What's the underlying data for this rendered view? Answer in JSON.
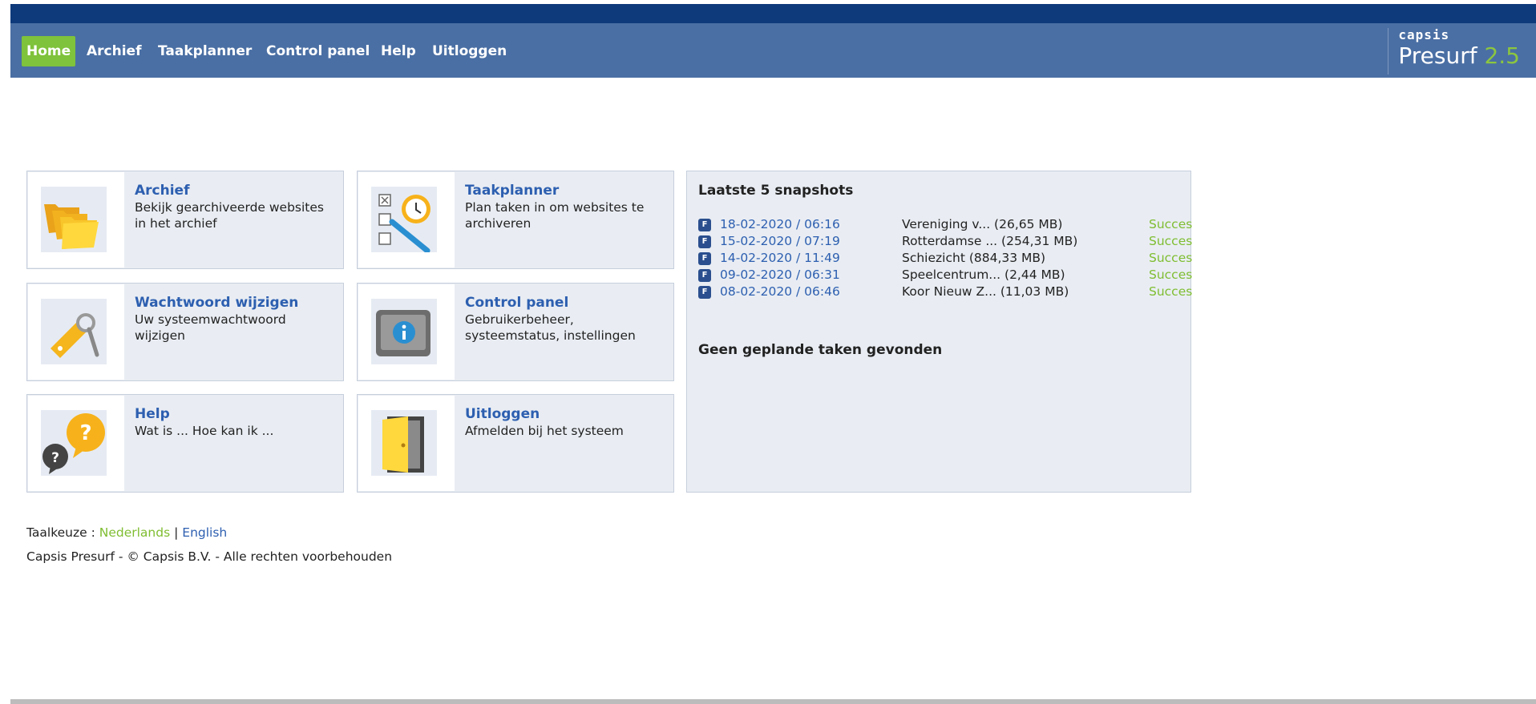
{
  "nav": {
    "items": [
      {
        "label": "Home",
        "active": true
      },
      {
        "label": "Archief"
      },
      {
        "label": "Taakplanner"
      },
      {
        "label": "Control panel"
      },
      {
        "label": "Help"
      },
      {
        "label": "Uitloggen"
      }
    ]
  },
  "logo": {
    "small": "capsis",
    "product": "Presurf",
    "version": "2.5"
  },
  "tiles": [
    {
      "title": "Archief",
      "desc": "Bekijk gearchiveerde websites in het archief",
      "icon": "folders-icon"
    },
    {
      "title": "Taakplanner",
      "desc": "Plan taken in om websites te archiveren",
      "icon": "task-planner-icon"
    },
    {
      "title": "Wachtwoord wijzigen",
      "desc": "Uw systeemwachtwoord wijzigen",
      "icon": "key-icon"
    },
    {
      "title": "Control panel",
      "desc": "Gebruikerbeheer, systeemstatus, instellingen",
      "icon": "info-monitor-icon"
    },
    {
      "title": "Help",
      "desc": "Wat is ... Hoe kan ik ...",
      "icon": "help-bubbles-icon"
    },
    {
      "title": "Uitloggen",
      "desc": "Afmelden bij het systeem",
      "icon": "door-icon"
    }
  ],
  "snapshots": {
    "title": "Laatste 5 snapshots",
    "badge": "F",
    "rows": [
      {
        "date": "18-02-2020 / 06:16",
        "name": "Vereniging v... (26,65 MB)",
        "status": "Succes"
      },
      {
        "date": "15-02-2020 / 07:19",
        "name": "Rotterdamse ... (254,31 MB)",
        "status": "Succes"
      },
      {
        "date": "14-02-2020 / 11:49",
        "name": "Schiezicht (884,33 MB)",
        "status": "Succes"
      },
      {
        "date": "09-02-2020 / 06:31",
        "name": "Speelcentrum... (2,44 MB)",
        "status": "Succes"
      },
      {
        "date": "08-02-2020 / 06:46",
        "name": "Koor Nieuw Z... (11,03 MB)",
        "status": "Succes"
      }
    ],
    "empty_tasks": "Geen geplande taken gevonden"
  },
  "footer": {
    "lang_label": "Taalkeuze :",
    "lang_nl": "Nederlands",
    "separator": "|",
    "lang_en": "English",
    "copyright": "Capsis Presurf - © Capsis B.V. - Alle rechten voorbehouden"
  },
  "colors": {
    "navbar": "#4a6fa4",
    "topstrip": "#0e3a7c",
    "active_nav": "#7fc23b",
    "link": "#2d5fb0",
    "success": "#7fbd31"
  }
}
